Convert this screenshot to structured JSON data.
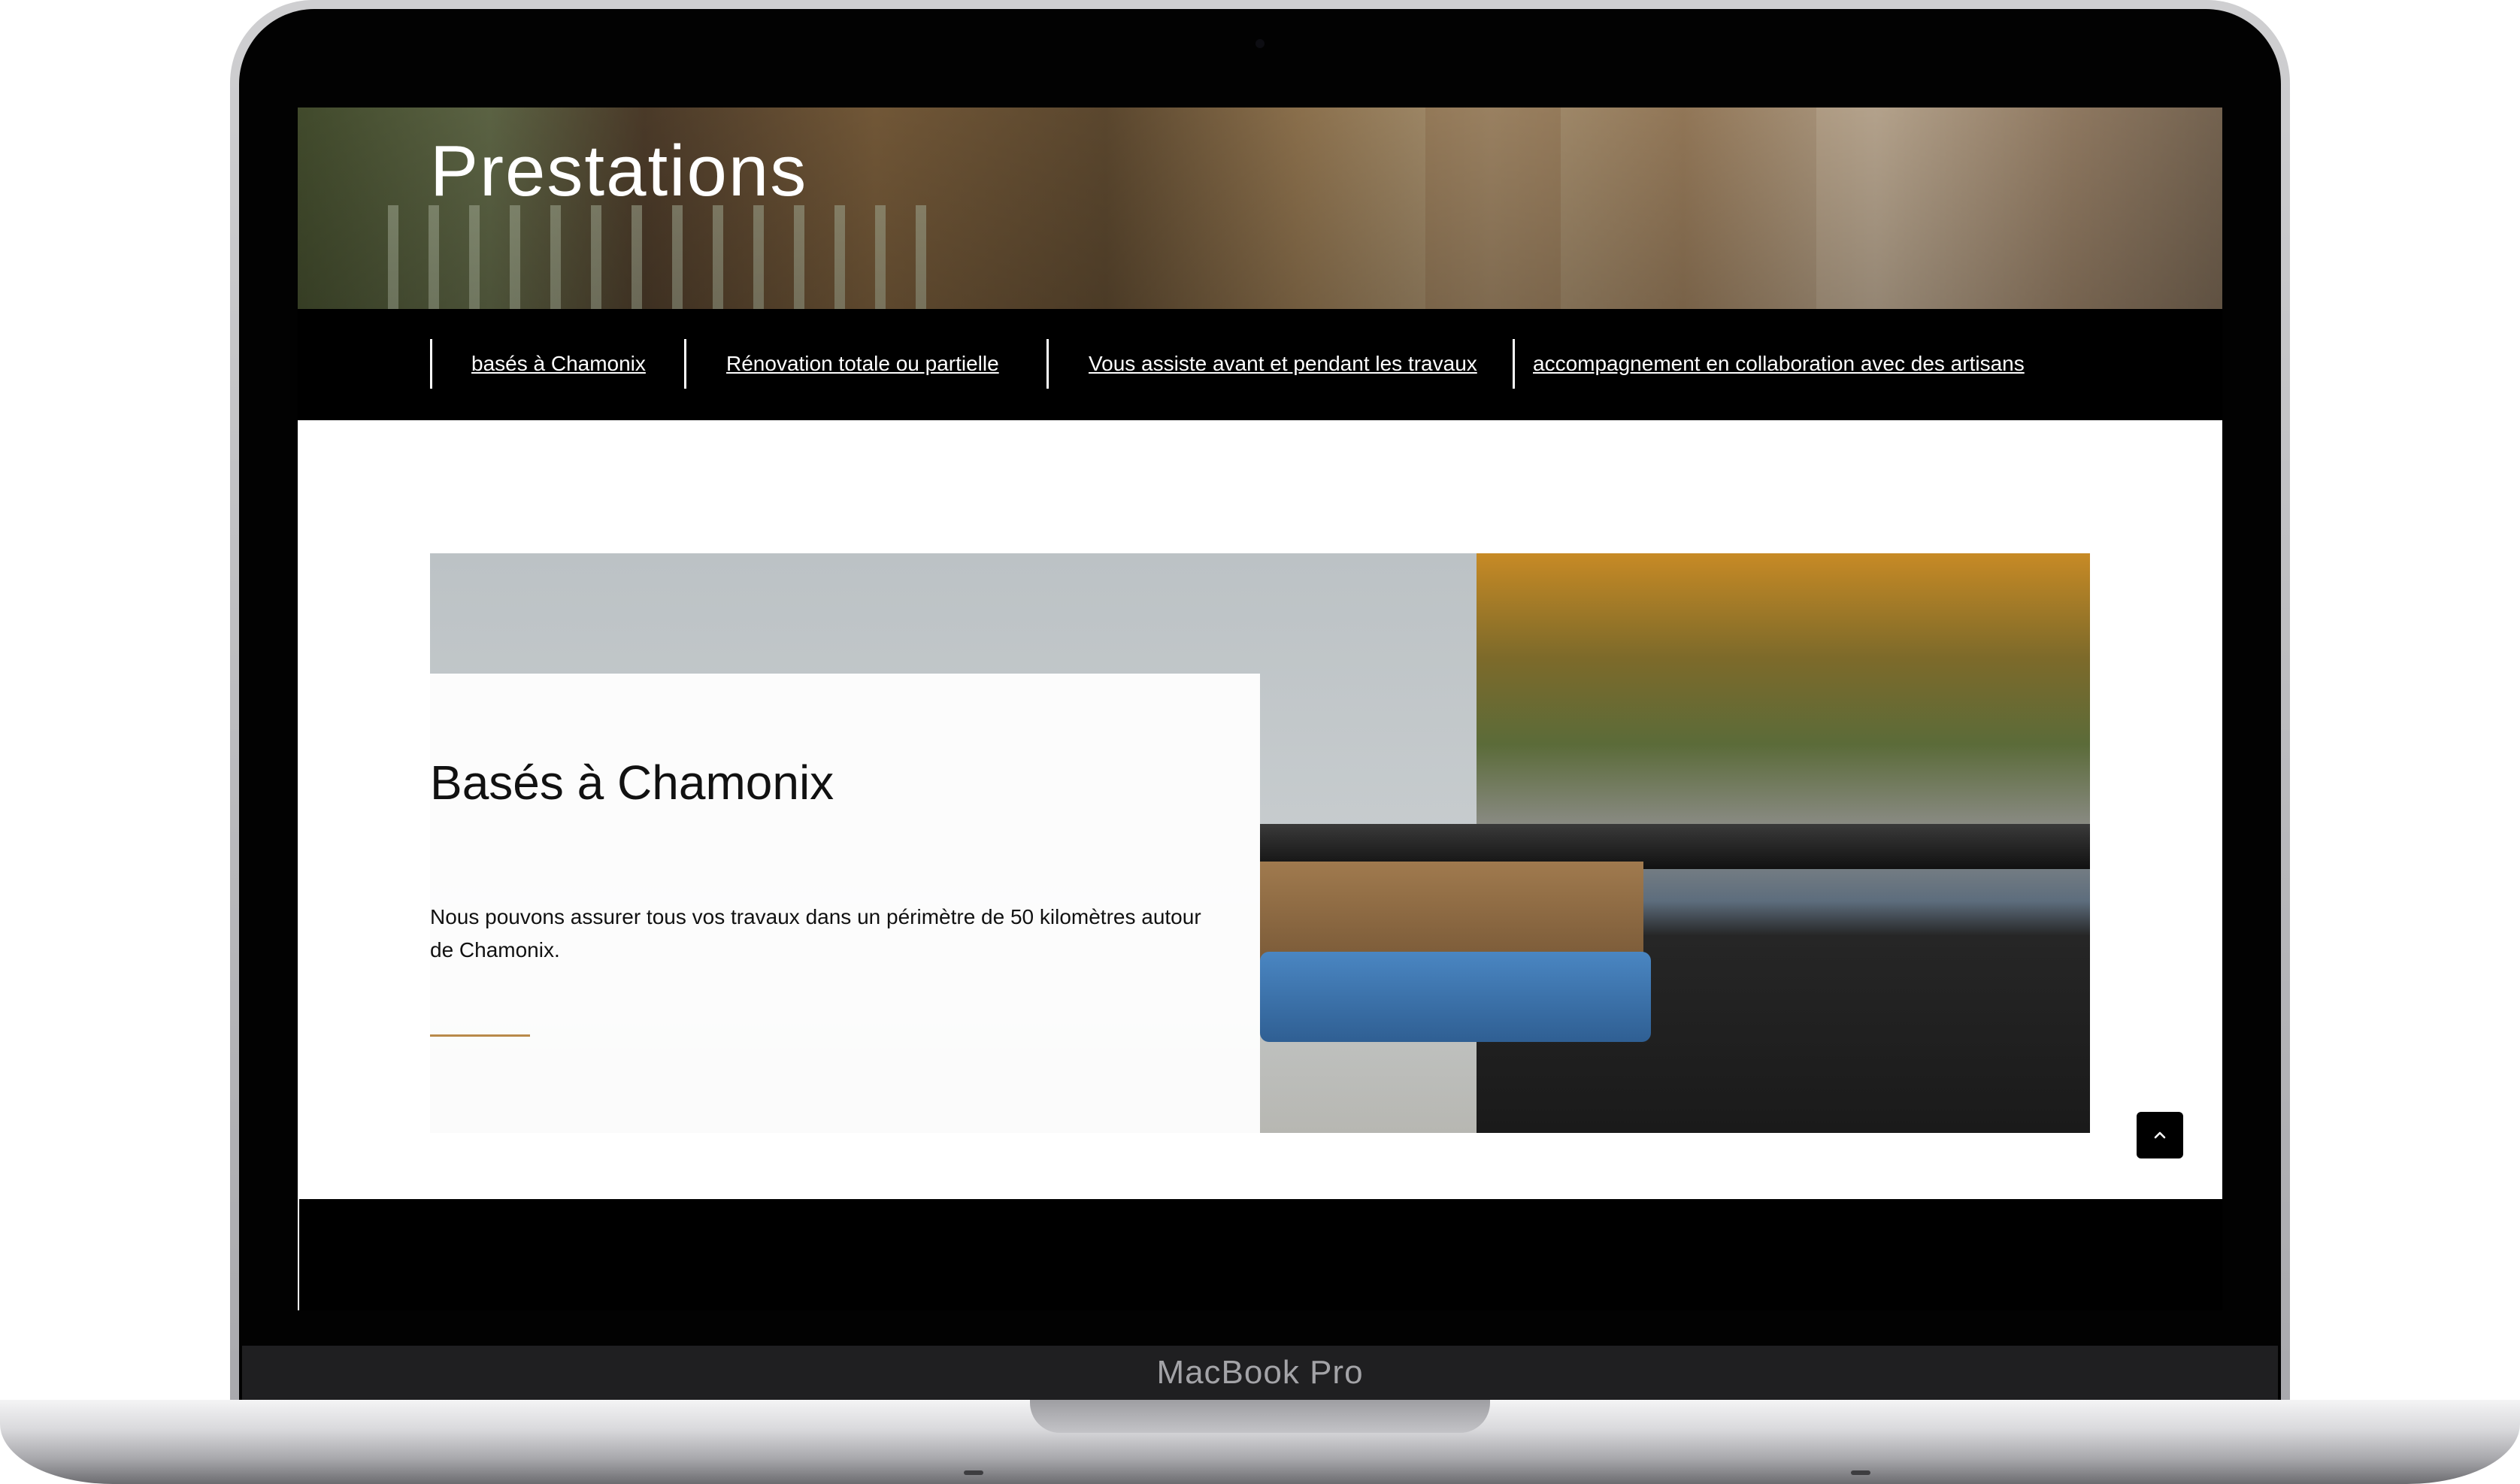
{
  "device": {
    "brand_label": "MacBook Pro"
  },
  "page": {
    "hero": {
      "title": "Prestations"
    },
    "nav": {
      "items": [
        {
          "label": "basés à Chamonix"
        },
        {
          "label": "Rénovation totale ou partielle"
        },
        {
          "label": "Vous assiste avant et pendant les travaux"
        },
        {
          "label": "accompagnement en collaboration avec des artisans"
        }
      ]
    },
    "feature": {
      "title": "Basés à Chamonix",
      "text": "Nous pouvons assurer tous vos travaux dans un périmètre de 50 kilomètres autour de Chamonix."
    },
    "scroll_top": {
      "icon": "chevron-up-icon"
    }
  },
  "colors": {
    "accent_rule": "#b98a4a",
    "nav_background": "#000000",
    "text": "#111111"
  }
}
